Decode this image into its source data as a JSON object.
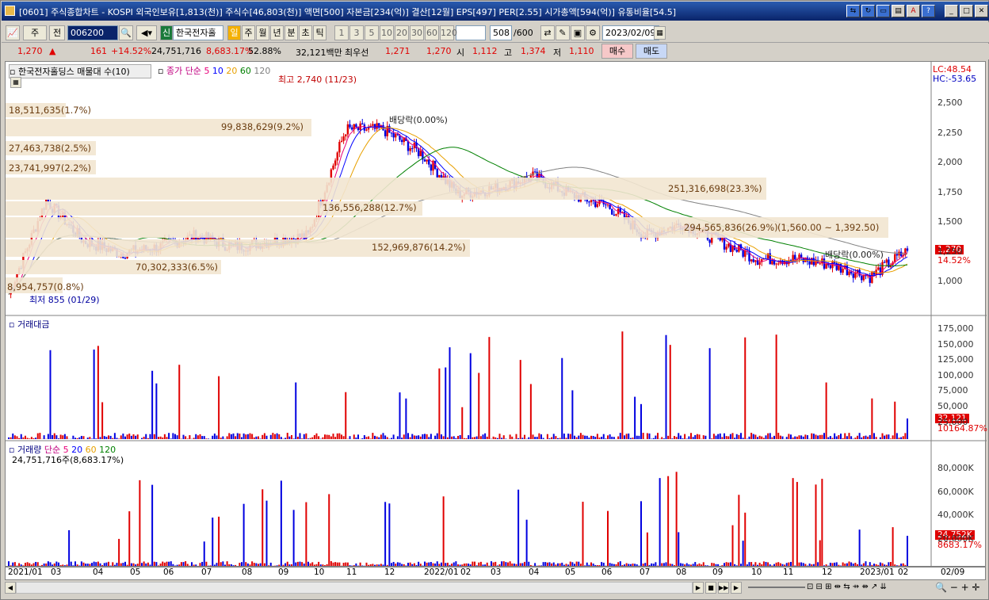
{
  "titlebar": {
    "title": "[0601] 주식종합차트 - KOSPI 외국인보유[1,813(천)] 주식수[46,803(천)] 액면[500] 자본금[234(억)] 결산[12월] EPS[497] PER[2.55] 시가총액[594(억)] 유통비율[54.5]"
  },
  "toolbar": {
    "market": "주",
    "prev": "전",
    "code": "006200",
    "stock_type": "신",
    "stock_name": "한국전자홀",
    "periods": [
      "일",
      "주",
      "월",
      "년",
      "분",
      "초",
      "틱"
    ],
    "intervals": [
      "1",
      "3",
      "5",
      "10",
      "20",
      "30",
      "60",
      "120"
    ],
    "count": "508",
    "count_max": "/600",
    "date": "2023/02/09"
  },
  "quote": {
    "price": "1,270",
    "arrow": "▲",
    "change": "161",
    "pct": "+14.52%",
    "volume": "24,751,716",
    "vol_pct": "8,683.17%",
    "vol_ratio": "52.88%",
    "amount": "32,121백만",
    "best_label": "최우선",
    "ask": "1,271",
    "bid": "1,270",
    "open_label": "시",
    "open": "1,112",
    "high_label": "고",
    "high": "1,374",
    "low_label": "저",
    "low": "1,110",
    "buy": "매수",
    "sell": "매도"
  },
  "price_panel": {
    "legend_name": "한국전자홀딩스 매물대 수(10)",
    "ma_label": "종가 단순",
    "mas": [
      "5",
      "10",
      "20",
      "60",
      "120"
    ],
    "ma_colors": [
      "#e8007a",
      "#0000ff",
      "#e8a000",
      "#008000",
      "#808080"
    ],
    "lc": "LC:48.54",
    "hc": "HC:-53.65",
    "high_mark": "최고 2,740 (11/23)",
    "low_mark": "최저 855 (01/29)",
    "div_mark1": "배당락(0.00%)",
    "div_mark2": "배당락(0.00%)",
    "current_tag": "1,270",
    "pct_tag": "14.52%",
    "yticks": [
      "2,500",
      "2,250",
      "2,000",
      "1,750",
      "1,500",
      "1,250",
      "1,000"
    ],
    "volume_profile": [
      "18,511,635(1.7%)",
      "99,838,629(9.2%)",
      "27,463,738(2.5%)",
      "23,741,997(2.2%)",
      "251,316,698(23.3%)",
      "136,556,288(12.7%)",
      "294,565,836(26.9%)",
      "(1,560.00 ~ 1,392.50)",
      "152,969,876(14.2%)",
      "70,302,333(6.5%)",
      "8,954,757(0.8%)"
    ]
  },
  "amount_panel": {
    "label": "거래대금",
    "yticks": [
      "175,000",
      "150,000",
      "125,000",
      "100,000",
      "75,000",
      "50,000",
      "25,000"
    ],
    "tag1": "32,121",
    "tag2": "10164.87%"
  },
  "volume_panel": {
    "label": "거래량",
    "ma_label": "단순",
    "mas": [
      "5",
      "20",
      "60",
      "120"
    ],
    "value_line": "24,751,716주(8,683.17%)",
    "yticks": [
      "80,000K",
      "60,000K",
      "40,000K",
      "20,000K"
    ],
    "tag1": "24,752K",
    "tag2": "8683.17%"
  },
  "xaxis": {
    "labels": [
      "2021/01",
      "03",
      "04",
      "05",
      "06",
      "07",
      "08",
      "09",
      "10",
      "11",
      "12",
      "2022/01",
      "02",
      "03",
      "04",
      "05",
      "06",
      "07",
      "08",
      "09",
      "10",
      "11",
      "12",
      "2023/01",
      "02"
    ],
    "end_label": "02/09"
  },
  "chart_data": {
    "type": "line",
    "title": "한국전자홀딩스",
    "ylim": [
      855,
      2740
    ],
    "x": [
      "2021/01",
      "2021/03",
      "2021/04",
      "2021/05",
      "2021/06",
      "2021/07",
      "2021/08",
      "2021/09",
      "2021/10",
      "2021/11",
      "2021/12",
      "2022/01",
      "2022/02",
      "2022/03",
      "2022/04",
      "2022/05",
      "2022/06",
      "2022/07",
      "2022/08",
      "2022/09",
      "2022/10",
      "2022/11",
      "2022/12",
      "2023/01",
      "2023/02"
    ],
    "series": [
      {
        "name": "종가",
        "values": [
          900,
          1700,
          1350,
          1250,
          1300,
          1400,
          1300,
          1350,
          1400,
          2300,
          2300,
          2100,
          1750,
          1800,
          1900,
          1750,
          1650,
          1400,
          1500,
          1350,
          1200,
          1200,
          1150,
          1050,
          1270
        ]
      }
    ]
  }
}
